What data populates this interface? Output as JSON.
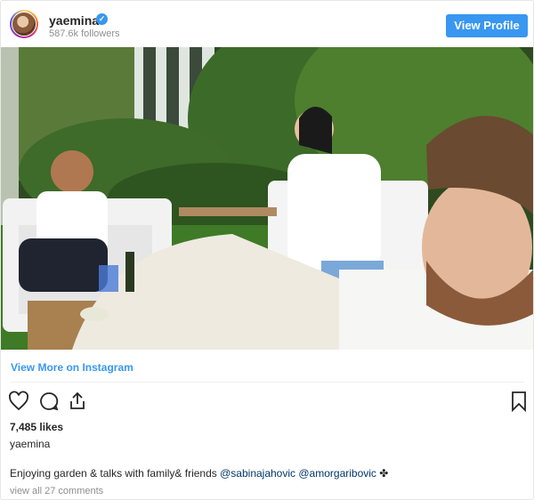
{
  "header": {
    "username": "yaemina",
    "followers": "587.6k followers",
    "view_profile_label": "View Profile"
  },
  "view_more_label": "View More on Instagram",
  "likes": "7,485 likes",
  "owner": "yaemina",
  "caption": {
    "text": "Enjoying garden & talks with family& friends",
    "mention_1": "@sabinajahovic",
    "mention_2": "@amorgaribovic",
    "emoji": "✤"
  },
  "comments_link": "view all 27 comments",
  "colors": {
    "accent": "#3897f0",
    "text": "#262626",
    "muted": "#8e8e8e",
    "border": "#efefef"
  },
  "icons": [
    "verified-badge-icon",
    "heart-icon",
    "comment-icon",
    "share-icon",
    "bookmark-icon"
  ]
}
